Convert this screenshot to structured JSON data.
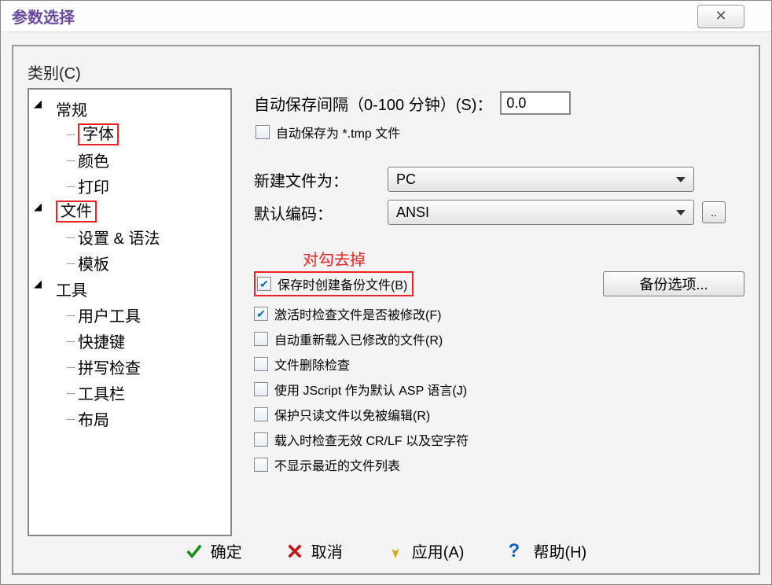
{
  "title": "参数选择",
  "close_glyph": "✕",
  "category_label": "类别(C)",
  "tree": {
    "general": "常规",
    "general_children": {
      "font": "字体",
      "color": "颜色",
      "print": "打印"
    },
    "file": "文件",
    "file_children": {
      "settings": "设置 & 语法",
      "template": "模板"
    },
    "tool": "工具",
    "tool_children": {
      "usertools": "用户工具",
      "hotkeys": "快捷键",
      "spell": "拼写检查",
      "toolbar": "工具栏",
      "layout": "布局"
    }
  },
  "right": {
    "autosave_label": "自动保存间隔（0-100 分钟）(S)：",
    "autosave_value": "0.0",
    "autosave_tmp": "自动保存为 *.tmp 文件",
    "newfile_label": "新建文件为：",
    "newfile_value": "PC",
    "encoding_label": "默认编码：",
    "encoding_value": "ANSI",
    "annotation": "对勾去掉",
    "backup_create": "保存时创建备份文件(B)",
    "backup_btn": "备份选项...",
    "check_active": "激活时检查文件是否被修改(F)",
    "check_reload": "自动重新载入已修改的文件(R)",
    "check_delete": "文件删除检查",
    "check_jscript": "使用 JScript 作为默认 ASP 语言(J)",
    "check_protect": "保护只读文件以免被编辑(R)",
    "check_crlf": "载入时检查无效 CR/LF 以及空字符",
    "check_norecent": "不显示最近的文件列表"
  },
  "footer": {
    "ok": "确定",
    "cancel": "取消",
    "apply": "应用(A)",
    "help": "帮助(H)"
  }
}
